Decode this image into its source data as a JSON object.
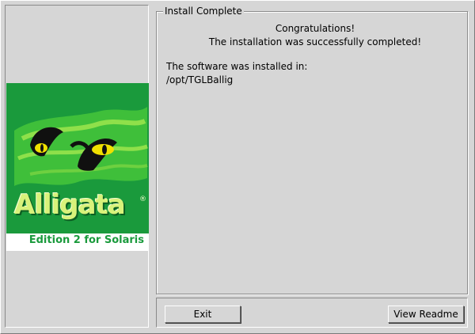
{
  "frame": {
    "title": "Install Complete"
  },
  "message": {
    "line1": "Congratulations!",
    "line2": "The installation was successfully completed!",
    "installed_label": "The software was installed in:",
    "install_path": "/opt/TGLBallig"
  },
  "logo": {
    "wordmark": "Alligata",
    "registered_mark": "®",
    "edition": "Edition 2 for Solaris",
    "colors": {
      "background": "#1a9a3c",
      "accent": "#d8f27a",
      "eye": "#f0e000"
    }
  },
  "buttons": {
    "exit_label": "Exit",
    "readme_label": "View Readme"
  }
}
